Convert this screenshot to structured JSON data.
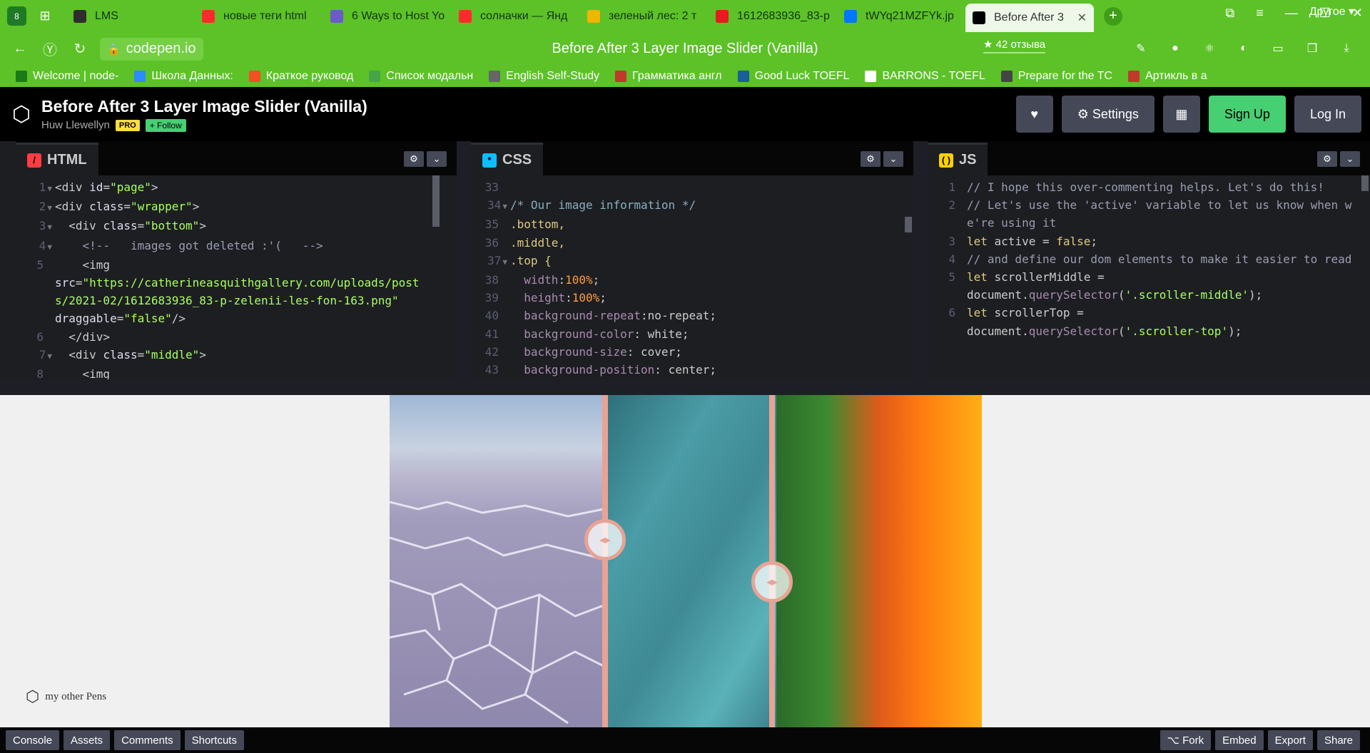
{
  "browser": {
    "tab_count": "8",
    "tabs": [
      {
        "title": "LMS",
        "color": "#2e2e2e"
      },
      {
        "title": "новые теги html",
        "color": "#ff2b2b"
      },
      {
        "title": "6 Ways to Host Yo",
        "color": "#6a5acd"
      },
      {
        "title": "солначки — Янд",
        "color": "#ff2b2b"
      },
      {
        "title": "зеленый лес: 2 т",
        "color": "#f2b400"
      },
      {
        "title": "1612683936_83-p",
        "color": "#e31d1d"
      },
      {
        "title": "tWYq21MZFYk.jp",
        "color": "#0077ff"
      },
      {
        "title": "Before After 3",
        "color": "#000000"
      }
    ],
    "url": "codepen.io",
    "page_title": "Before After 3 Layer Image Slider (Vanilla)",
    "reviews": "★ 42 отзыва",
    "bookmarks": [
      {
        "label": "Welcome | node-",
        "color": "#1a7a1a"
      },
      {
        "label": "Школа Данных: ",
        "color": "#2a8cff"
      },
      {
        "label": "Краткое руковод",
        "color": "#f25022"
      },
      {
        "label": "Список модальн",
        "color": "#47a447"
      },
      {
        "label": "English Self-Study",
        "color": "#666666"
      },
      {
        "label": "Грамматика англ",
        "color": "#c0392b"
      },
      {
        "label": "Good Luck TOEFL",
        "color": "#1a5e9a"
      },
      {
        "label": "BARRONS - TOEFL",
        "color": "#ffffff"
      },
      {
        "label": "Prepare for the TC",
        "color": "#444444"
      },
      {
        "label": "Артикль в а",
        "color": "#c0392b"
      }
    ],
    "bookmarks_other": "Другое ▾"
  },
  "codepen": {
    "title": "Before After 3 Layer Image Slider (Vanilla)",
    "author": "Huw Llewellyn",
    "pro_badge": "PRO",
    "follow_label": "+ Follow",
    "heart_icon": "♥",
    "settings_label": "⚙ Settings",
    "layout_icon": "▦",
    "signup_label": "Sign Up",
    "login_label": "Log In",
    "other_pens": "my other Pens"
  },
  "editors": {
    "html": {
      "label": "HTML",
      "lines": [
        {
          "n": "1",
          "fold": true,
          "text": "<div id=\"page\">"
        },
        {
          "n": "2",
          "fold": true,
          "text": "<div class=\"wrapper\">"
        },
        {
          "n": "3",
          "fold": true,
          "text": "  <div class=\"bottom\">"
        },
        {
          "n": "4",
          "fold": true,
          "text": "    <!--   images got deleted :'(   -->"
        },
        {
          "n": "5",
          "fold": false,
          "text": "    <img"
        },
        {
          "n": "",
          "fold": false,
          "text": "src=\"https://catherineasquithgallery.com/uploads/posts/2021-02/1612683936_83-p-zelenii-les-fon-163.png\""
        },
        {
          "n": "",
          "fold": false,
          "text": "draggable=\"false\"/>"
        },
        {
          "n": "6",
          "fold": false,
          "text": "  </div>"
        },
        {
          "n": "7",
          "fold": true,
          "text": "  <div class=\"middle\">"
        },
        {
          "n": "8",
          "fold": false,
          "text": "    <img"
        }
      ]
    },
    "css": {
      "label": "CSS",
      "lines": [
        {
          "n": "33",
          "fold": false,
          "text": ""
        },
        {
          "n": "34",
          "fold": true,
          "text": "/* Our image information */"
        },
        {
          "n": "35",
          "fold": false,
          "text": ".bottom,"
        },
        {
          "n": "36",
          "fold": false,
          "text": ".middle,"
        },
        {
          "n": "37",
          "fold": true,
          "text": ".top {"
        },
        {
          "n": "38",
          "fold": false,
          "text": "  width:100%;"
        },
        {
          "n": "39",
          "fold": false,
          "text": "  height:100%;"
        },
        {
          "n": "40",
          "fold": false,
          "text": "  background-repeat:no-repeat;"
        },
        {
          "n": "41",
          "fold": false,
          "text": "  background-color: white;"
        },
        {
          "n": "42",
          "fold": false,
          "text": "  background-size: cover;"
        },
        {
          "n": "43",
          "fold": false,
          "text": "  background-position: center;"
        }
      ]
    },
    "js": {
      "label": "JS",
      "lines": [
        {
          "n": "1",
          "fold": false,
          "text": "// I hope this over-commenting helps. Let's do this!"
        },
        {
          "n": "2",
          "fold": false,
          "text": "// Let's use the 'active' variable to let us know when we're using it"
        },
        {
          "n": "3",
          "fold": false,
          "text": "let active = false;"
        },
        {
          "n": "4",
          "fold": false,
          "text": "// and define our dom elements to make it easier to read"
        },
        {
          "n": "5",
          "fold": false,
          "text": "let scrollerMiddle ="
        },
        {
          "n": "",
          "fold": false,
          "text": "document.querySelector('.scroller-middle');"
        },
        {
          "n": "6",
          "fold": false,
          "text": "let scrollerTop ="
        },
        {
          "n": "",
          "fold": false,
          "text": "document.querySelector('.scroller-top');"
        }
      ]
    }
  },
  "bottom_bar": {
    "left": [
      "Console",
      "Assets",
      "Comments",
      "Shortcuts"
    ],
    "right": [
      "⌥ Fork",
      "Embed",
      "Export",
      "Share"
    ]
  }
}
